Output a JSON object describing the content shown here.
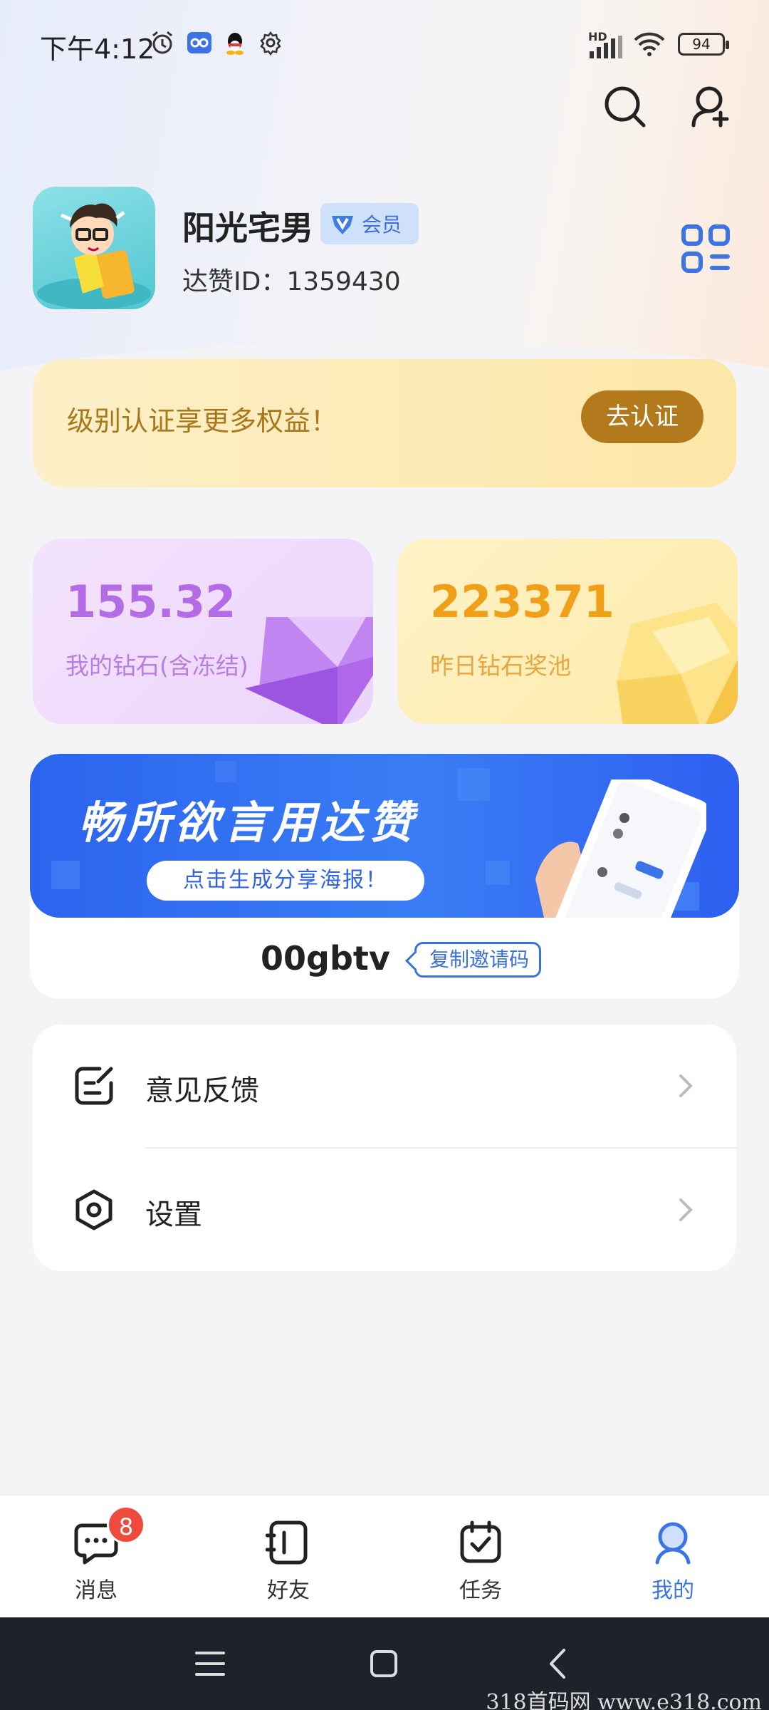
{
  "status_bar": {
    "time": "下午4:12",
    "network": "HD",
    "battery": "94"
  },
  "profile": {
    "nickname": "阳光宅男",
    "vip_label": "会员",
    "user_id": "达赞ID：1359430"
  },
  "cert_banner": {
    "text": "级别认证享更多权益！",
    "button": "去认证"
  },
  "cards": {
    "diamonds_value": "155.32",
    "diamonds_caption": "我的钻石(含冻结)",
    "pool_value": "223371",
    "pool_caption": "昨日钻石奖池"
  },
  "invite": {
    "banner_title": "畅所欲言用达赞",
    "banner_button": "点击生成分享海报！",
    "code": "00gbtv",
    "copy_button": "复制邀请码"
  },
  "menu": {
    "items": [
      {
        "label": "意见反馈",
        "icon": "feedback-edit-icon"
      },
      {
        "label": "设置",
        "icon": "settings-hexagon-icon"
      }
    ]
  },
  "tabbar": {
    "messages_label": "消息",
    "messages_badge": "8",
    "friends_label": "好友",
    "tasks_label": "任务",
    "me_label": "我的",
    "active": "me"
  },
  "watermark": "318首码网  www.e318.com",
  "colors": {
    "accent_blue": "#3b74e6",
    "gold_button": "#b37a1d",
    "diamond_purple": "#b46be6",
    "pool_orange": "#f0a018",
    "badge_red": "#ee4b3c"
  }
}
